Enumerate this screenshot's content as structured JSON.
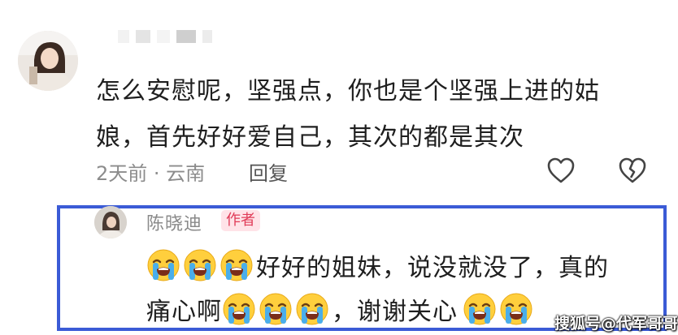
{
  "comment": {
    "username_redacted": "",
    "text": "怎么安慰呢，坚强点，你也是个坚强上进的姑娘，首先好好爱自己，其次的都是其次",
    "meta": "2天前 · 云南",
    "reply_label": "回复",
    "like_icon": "heart-outline-icon",
    "dislike_icon": "broken-heart-icon"
  },
  "reply": {
    "author": "陈晓迪",
    "badge": "作者",
    "line1_text": "好好的姐妹，说没就没了，真的",
    "line2_text_a": "痛心啊",
    "line2_text_b": "，谢谢关心",
    "emoji_icon": "loudly-crying-face-icon",
    "highlight_color": "#3b5bd6"
  },
  "watermark": "搜狐号@代军哥哥"
}
